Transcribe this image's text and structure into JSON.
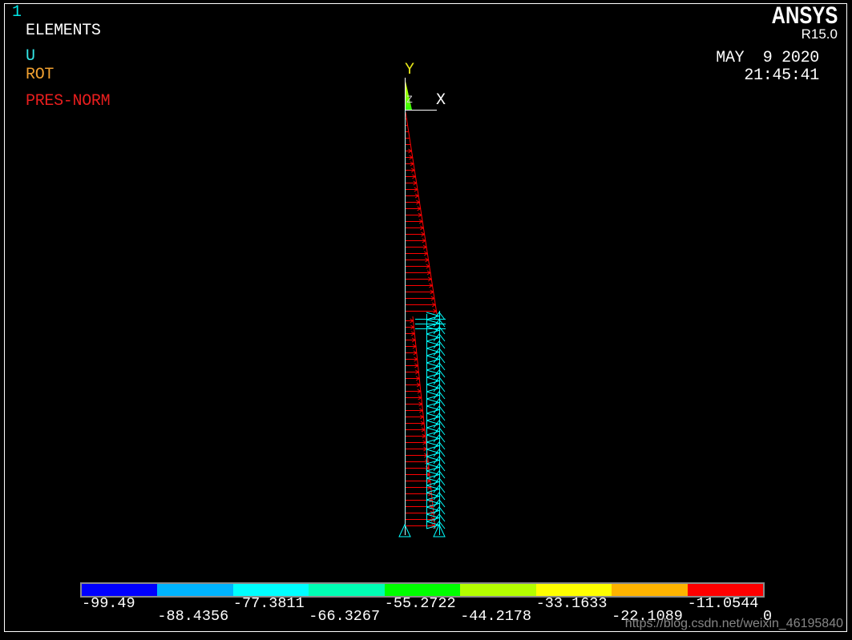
{
  "window": {
    "number": "1",
    "number_color": "#00e5e5",
    "background": "#000000"
  },
  "brand": {
    "name": "ANSYS",
    "release": "R15.0"
  },
  "timestamp": {
    "date": "MAY  9 2020",
    "time": "21:45:41"
  },
  "plot_info": {
    "display": "ELEMENTS",
    "legend": [
      {
        "label": "U",
        "color": "#33e6e6"
      },
      {
        "label": "ROT",
        "color": "#f0a030"
      },
      {
        "label": "PRES-NORM",
        "color": "#e81e1e"
      }
    ]
  },
  "triad": {
    "x_label": "X",
    "y_label": "Y",
    "z_label": "Z"
  },
  "model": {
    "pressure_color": "#ff0000",
    "constraint_color": "#00ffff",
    "element_color": "#c8ffff"
  },
  "contour_legend": {
    "colors": [
      "#0000ff",
      "#00b4ff",
      "#00ffff",
      "#00ffb4",
      "#00ff00",
      "#b4ff00",
      "#ffff00",
      "#ffb400",
      "#ff0000"
    ],
    "labels": [
      "-99.49",
      "-88.4356",
      "-77.3811",
      "-66.3267",
      "-55.2722",
      "-44.2178",
      "-33.1633",
      "-22.1089",
      "-11.0544",
      "0"
    ]
  },
  "watermark": "https://blog.csdn.net/weixin_46195840"
}
